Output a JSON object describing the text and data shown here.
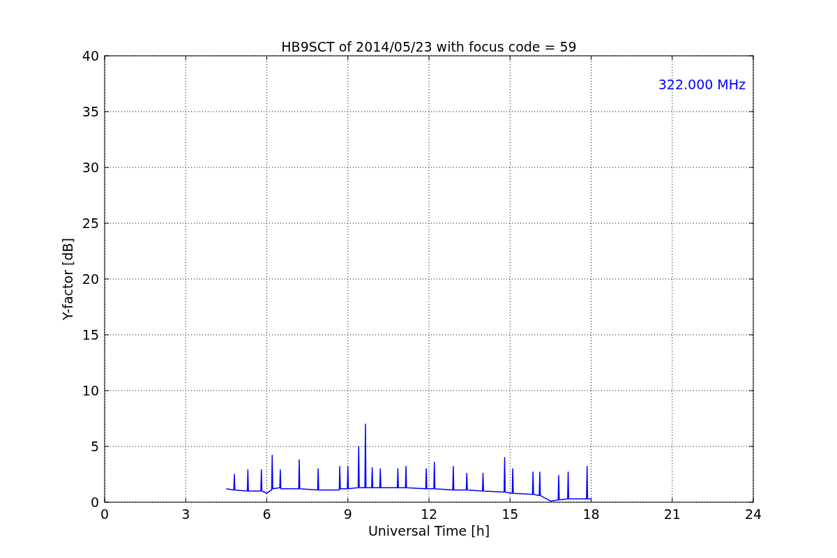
{
  "chart_data": {
    "type": "line",
    "title": "HB9SCT of 2014/05/23 with focus code = 59",
    "xlabel": "Universal Time [h]",
    "ylabel": "Y-factor [dB]",
    "x": [
      4.5,
      4.78,
      4.8,
      4.82,
      5.28,
      5.3,
      5.32,
      5.78,
      5.8,
      5.82,
      6.0,
      6.18,
      6.2,
      6.22,
      6.48,
      6.5,
      6.52,
      7.18,
      7.2,
      7.22,
      7.88,
      7.9,
      7.92,
      8.68,
      8.7,
      8.72,
      8.98,
      9.0,
      9.02,
      9.38,
      9.4,
      9.42,
      9.63,
      9.65,
      9.67,
      9.88,
      9.9,
      9.92,
      10.18,
      10.2,
      10.22,
      10.83,
      10.85,
      10.87,
      11.13,
      11.15,
      11.17,
      11.88,
      11.9,
      11.92,
      12.18,
      12.2,
      12.22,
      12.88,
      12.9,
      12.92,
      13.38,
      13.4,
      13.42,
      13.98,
      14.0,
      14.02,
      14.78,
      14.8,
      14.82,
      15.08,
      15.1,
      15.12,
      15.83,
      15.85,
      15.87,
      16.08,
      16.1,
      16.12,
      16.5,
      16.78,
      16.8,
      16.82,
      17.13,
      17.15,
      17.17,
      17.83,
      17.85,
      17.87,
      18.0
    ],
    "series": [
      {
        "color": "#0000ff",
        "values": [
          1.2,
          1.1,
          2.5,
          1.1,
          1.0,
          2.9,
          1.0,
          1.0,
          2.9,
          1.0,
          0.8,
          1.1,
          4.2,
          1.2,
          1.3,
          2.9,
          1.2,
          1.2,
          3.8,
          1.2,
          1.1,
          3.0,
          1.1,
          1.1,
          3.2,
          1.2,
          1.2,
          3.2,
          1.2,
          1.3,
          5.0,
          1.3,
          1.3,
          7.0,
          1.3,
          1.3,
          3.1,
          1.3,
          1.3,
          3.0,
          1.3,
          1.3,
          3.0,
          1.3,
          1.3,
          3.2,
          1.3,
          1.2,
          3.0,
          1.2,
          1.2,
          3.6,
          1.2,
          1.1,
          3.2,
          1.1,
          1.1,
          2.6,
          1.1,
          1.0,
          2.6,
          1.0,
          0.9,
          4.0,
          0.9,
          0.8,
          3.0,
          0.8,
          0.7,
          2.7,
          0.7,
          0.6,
          2.7,
          0.6,
          0.1,
          0.2,
          2.4,
          0.2,
          0.3,
          2.7,
          0.3,
          0.3,
          3.2,
          0.3,
          0.3
        ]
      }
    ],
    "xlim": [
      0,
      24
    ],
    "ylim": [
      0,
      40
    ],
    "xticks": [
      0,
      3,
      6,
      9,
      12,
      15,
      18,
      21,
      24
    ],
    "yticks": [
      0,
      5,
      10,
      15,
      20,
      25,
      30,
      35,
      40
    ],
    "grid": true,
    "annotations": [
      "322.000 MHz"
    ]
  }
}
